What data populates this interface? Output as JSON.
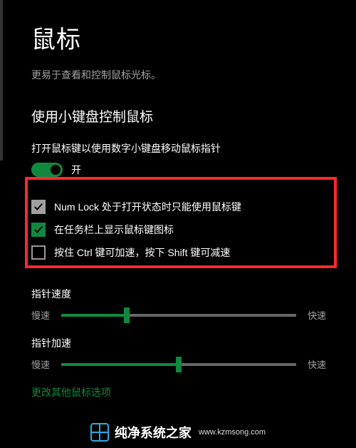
{
  "page_title": "鼠标",
  "description": "更易于查看和控制鼠标光标。",
  "section_title": "使用小键盘控制鼠标",
  "toggle": {
    "label": "打开鼠标键以使用数字小键盘移动鼠标指针",
    "state_text": "开",
    "on": true
  },
  "checkboxes": [
    {
      "label": "Num Lock 处于打开状态时只能使用鼠标键",
      "checked": true,
      "accent": "gray"
    },
    {
      "label": "在任务栏上显示鼠标键图标",
      "checked": true,
      "accent": "green"
    },
    {
      "label": "按住 Ctrl 键可加速，按下 Shift 键可减速",
      "checked": false,
      "accent": "none"
    }
  ],
  "sliders": {
    "speed": {
      "title": "指针速度",
      "left": "慢速",
      "right": "快速",
      "pct": 28
    },
    "accel": {
      "title": "指针加速",
      "left": "慢速",
      "right": "快速",
      "pct": 50
    }
  },
  "link_text": "更改其他鼠标选项",
  "watermark": {
    "cn": "纯净系统之家",
    "url": "www.kzmsong.com"
  }
}
